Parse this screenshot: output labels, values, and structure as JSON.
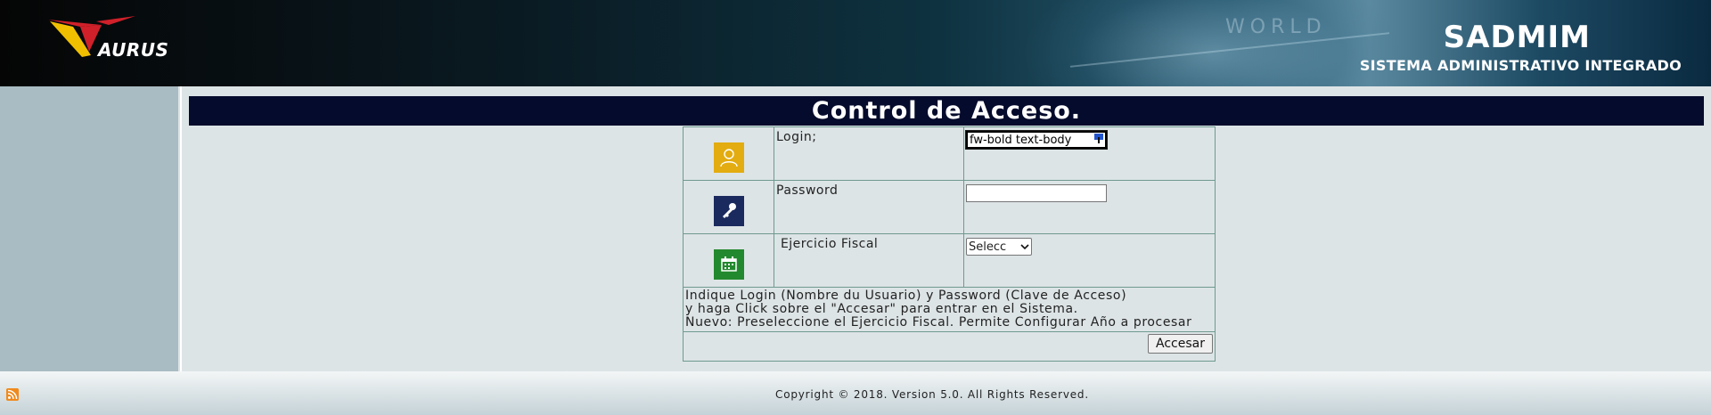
{
  "header": {
    "logo_text": "AURUS",
    "app_name": "SADMIM",
    "app_subtitle": "SISTEMA ADMINISTRATIVO INTEGRADO",
    "background_word": "WORLD"
  },
  "page": {
    "title": "Control de Acceso."
  },
  "form": {
    "login_label": "Login;",
    "login_value": "fw-bold text-body",
    "password_label": "Password",
    "password_value": "",
    "fiscal_label": " Ejercicio Fiscal",
    "fiscal_selected": "Selecc",
    "info_line1": "Indique Login (Nombre du Usuario) y Password (Clave de Acceso)",
    "info_line2": "y haga Click sobre el \"Accesar\" para entrar en el Sistema.",
    "info_line3": "Nuevo: Preseleccione el Ejercicio Fiscal. Permite Configurar Año a procesar",
    "submit_label": "Accesar"
  },
  "icons": {
    "user": "user-icon",
    "key": "key-icon",
    "calendar": "calendar-icon",
    "rss": "rss-icon",
    "keyboard": "keyboard-icon",
    "chevron": "chevron-down-icon"
  },
  "colors": {
    "title_bar": "#050b2c",
    "user_icon_bg": "#e3ac10",
    "key_icon_bg": "#1a2a5e",
    "calendar_icon_bg": "#23892e",
    "left_panel": "#a9bcc3",
    "logo_red": "#d0202a",
    "logo_yellow": "#f0c000"
  },
  "footer": {
    "copyright": "Copyright © 2018. Version 5.0. All Rights Reserved."
  }
}
